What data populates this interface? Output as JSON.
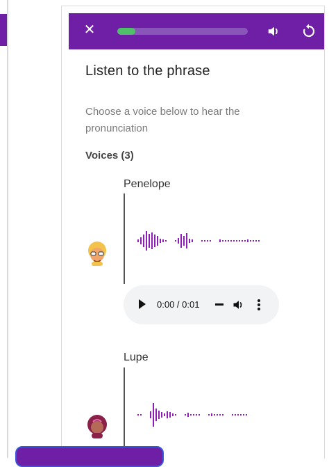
{
  "header": {
    "close_icon": "close-icon",
    "progress_fraction": 0.14,
    "speaker_icon": "speaker-icon",
    "restart_icon": "restart-icon",
    "colors": {
      "bar": "#6f1ea6",
      "progress_track": "#8a55b9",
      "progress_fill": "#4fbf6a"
    }
  },
  "main": {
    "title": "Listen to the phrase",
    "instructions": "Choose a voice below to hear the pronunciation",
    "voices_label": "Voices (3)"
  },
  "voices": [
    {
      "name": "Penelope",
      "avatar_icon": "avatar-penelope-icon",
      "player": {
        "time": "0:00 / 0:01"
      }
    },
    {
      "name": "Lupe",
      "avatar_icon": "avatar-lupe-icon"
    }
  ],
  "colors": {
    "waveform": "#8d1cb8",
    "text_muted": "#7a7a7a"
  }
}
